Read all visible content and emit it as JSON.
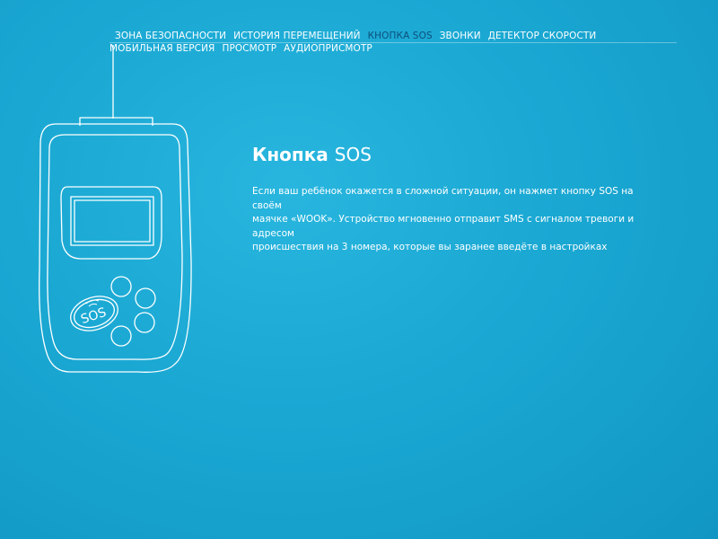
{
  "nav": {
    "row1": [
      {
        "label": "ЗОНА БЕЗОПАСНОСТИ",
        "active": false
      },
      {
        "label": "ИСТОРИЯ  ПЕРЕМЕЩЕНИЙ",
        "active": false
      },
      {
        "label": "КНОПКА SOS",
        "active": true
      },
      {
        "label": "ЗВОНКИ",
        "active": false
      },
      {
        "label": "ДЕТЕКТОР СКОРОСТИ",
        "active": false
      }
    ],
    "row2": [
      {
        "label": "МОБИЛЬНАЯ ВЕРСИЯ",
        "active": false
      },
      {
        "label": "ПРОСМОТР",
        "active": false
      },
      {
        "label": "АУДИОПРИСМОТР",
        "active": false
      }
    ]
  },
  "device": {
    "button_label": "SOS"
  },
  "content": {
    "title_cyr": "Кнопка ",
    "title_lat": "SOS",
    "description_lines": [
      "Если ваш ребёнок окажется в сложной ситуации, он нажмет кнопку SOS на",
      "своём",
      "маячке «WOOK». Устройство мгновенно отправит SMS с сигналом тревоги и",
      "адресом",
      "происшествия на 3 номера, которые вы заранее введёте в настройках"
    ]
  },
  "colors": {
    "background": "#1aa8d3",
    "active_nav": "#0d4f7a",
    "text": "#ffffff"
  }
}
